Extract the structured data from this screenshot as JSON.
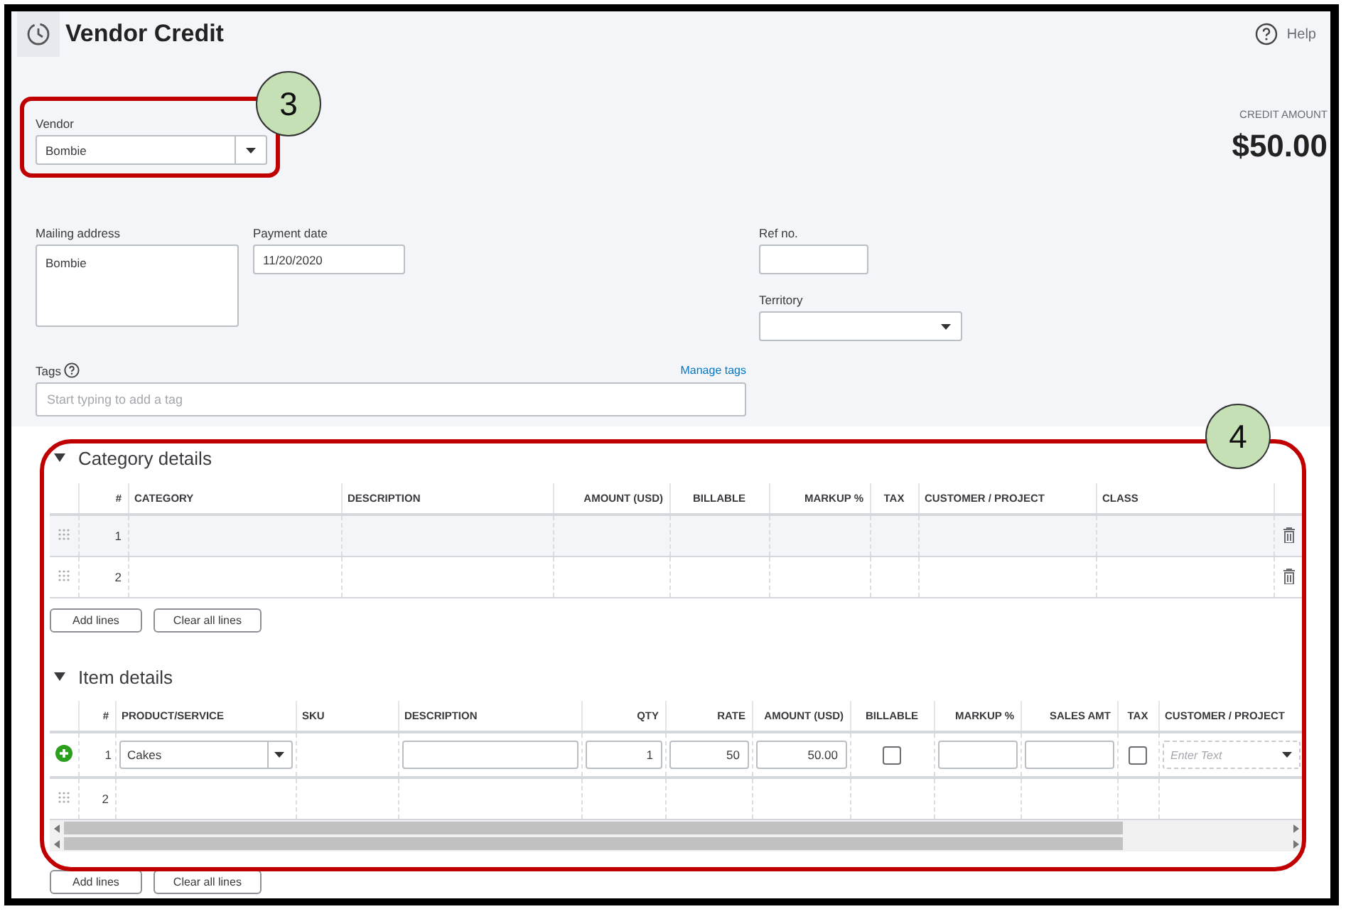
{
  "window": {
    "title": "Vendor Credit",
    "help": "Help"
  },
  "vendor": {
    "label": "Vendor",
    "value": "Bombie"
  },
  "credit_amount": {
    "label": "CREDIT AMOUNT",
    "value": "$50.00"
  },
  "mailing_address": {
    "label": "Mailing address",
    "value": "Bombie"
  },
  "payment_date": {
    "label": "Payment date",
    "value": "11/20/2020"
  },
  "ref_no": {
    "label": "Ref no."
  },
  "territory": {
    "label": "Territory"
  },
  "tags": {
    "label": "Tags",
    "link": "Manage tags",
    "placeholder": "Start typing to add a tag"
  },
  "category_details": {
    "title": "Category details",
    "expanded": true,
    "columns": [
      "#",
      "CATEGORY",
      "DESCRIPTION",
      "AMOUNT (USD)",
      "BILLABLE",
      "MARKUP %",
      "TAX",
      "CUSTOMER / PROJECT",
      "CLASS"
    ],
    "rows": [
      {
        "number": "1",
        "selected": true
      },
      {
        "number": "2",
        "selected": false
      }
    ],
    "buttons": [
      "Add lines",
      "Clear all lines"
    ]
  },
  "item_details": {
    "title": "Item details",
    "expanded": true,
    "columns": [
      "#",
      "PRODUCT/SERVICE",
      "SKU",
      "DESCRIPTION",
      "QTY",
      "RATE",
      "AMOUNT (USD)",
      "BILLABLE",
      "MARKUP %",
      "SALES AMT",
      "TAX",
      "CUSTOMER / PROJECT"
    ],
    "rows": [
      {
        "number": "1",
        "kind": "edit",
        "product": "Cakes",
        "qty": "1",
        "rate": "50",
        "amount": "50.00",
        "billable": false,
        "tax": false,
        "customer_placeholder": "Enter Text"
      },
      {
        "number": "2",
        "kind": "empty"
      }
    ],
    "buttons": [
      "Add lines",
      "Clear all lines"
    ]
  },
  "annotations": [
    {
      "label": "3"
    },
    {
      "label": "4"
    }
  ]
}
